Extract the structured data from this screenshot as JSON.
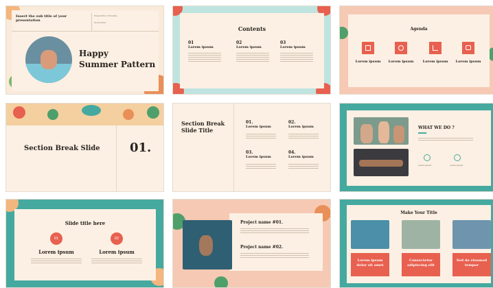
{
  "slides": [
    {
      "subtitle": "Insert the sub title of your presentation",
      "title_line1": "Happy",
      "title_line2": "Summer Pattern",
      "meta1": "Presentation Template",
      "meta2": "00.00.2024"
    },
    {
      "title": "Contents",
      "items": [
        {
          "num": "01",
          "label": "Lorem ipsum"
        },
        {
          "num": "02",
          "label": "Lorem ipsum"
        },
        {
          "num": "03",
          "label": "Lorem ipsum"
        }
      ]
    },
    {
      "title": "Agenda",
      "items": [
        "Lorem ipsum",
        "Lorem ipsum",
        "Lorem ipsum",
        "Lorem ipsum"
      ]
    },
    {
      "title": "Section Break Slide",
      "num": "01."
    },
    {
      "title_line1": "Section Break",
      "title_line2": "Slide Title",
      "items": [
        {
          "num": "01.",
          "label": "Lorem ipsum"
        },
        {
          "num": "02.",
          "label": "Lorem ipsum"
        },
        {
          "num": "03.",
          "label": "Lorem ipsum"
        },
        {
          "num": "04.",
          "label": "Lorem ipsum"
        }
      ]
    },
    {
      "title": "WHAT WE DO ?",
      "icon_labels": [
        "Lorem ipsum",
        "Lorem ipsum"
      ]
    },
    {
      "title": "Slide title here",
      "items": [
        {
          "num": "01",
          "label": "Lorem ipsum"
        },
        {
          "num": "02",
          "label": "Lorem ipsum"
        }
      ]
    },
    {
      "items": [
        "Project name #01.",
        "Project name #02."
      ]
    },
    {
      "title": "Make Your Title",
      "cards": [
        "Lorem ipsum dolor sit amet",
        "Consectetur adipiscing elit",
        "Sed do eiusmod tempor"
      ]
    }
  ],
  "colors": {
    "coral": "#e8604f",
    "teal": "#45a9a0",
    "cream": "#fbf0e3",
    "peach": "#f6c9b4",
    "mint": "#bfe4df"
  }
}
